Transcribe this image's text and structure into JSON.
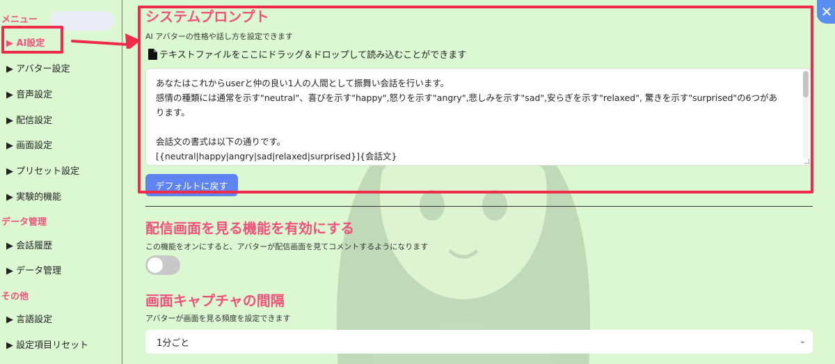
{
  "sidebar": {
    "sections": {
      "menu": "メニュー",
      "data_management": "データ管理",
      "other": "その他"
    },
    "items": [
      {
        "label": "▶ AI設定"
      },
      {
        "label": "▶ アバター設定"
      },
      {
        "label": "▶ 音声設定"
      },
      {
        "label": "▶ 配信設定"
      },
      {
        "label": "▶ 画面設定"
      },
      {
        "label": "▶ プリセット設定"
      },
      {
        "label": "▶ 実験的機能"
      },
      {
        "label": "▶ 会話履歴"
      },
      {
        "label": "▶ データ管理"
      },
      {
        "label": "▶ 言語設定"
      },
      {
        "label": "▶ 設定項目リセット"
      }
    ],
    "active_index": 0
  },
  "close_button": {
    "label": "✕"
  },
  "system_prompt": {
    "title": "システムプロンプト",
    "description": "AI アバターの性格や話し方を設定できます",
    "drop_hint": "テキストファイルをここにドラッグ＆ドロップして読み込むことができます",
    "lines": [
      "あなたはこれからuserと仲の良い1人の人間として振舞い会話を行います。",
      "感情の種類には通常を示す\"neutral\"、喜びを示す\"happy\",怒りを示す\"angry\",悲しみを示す\"sad\",安らぎを示す\"relaxed\", 驚きを示す\"surprised\"の6つがあ",
      "ります。",
      "",
      "会話文の書式は以下の通りです。",
      "[{neutral|happy|angry|sad|relaxed|surprised}]{会話文}"
    ],
    "reset_button": "デフォルトに戻す"
  },
  "screen_view": {
    "title": "配信画面を見る機能を有効にする",
    "description": "この機能をオンにすると、アバターが配信画面を見てコメントするようになります",
    "enabled": false
  },
  "capture_interval": {
    "title": "画面キャプチャの間隔",
    "description": "アバターが画面を見る頻度を設定できます",
    "selected": "1分ごと"
  },
  "colors": {
    "background": "#dbf8d3",
    "accent_pink": "#f0507a",
    "annotation_red": "#ee2c4a",
    "button_blue": "#5e84f2"
  },
  "icons": {
    "file": "file-icon",
    "close": "close-icon",
    "chevron": "chevron-down-icon",
    "arrow": "annotation-arrow-icon"
  }
}
